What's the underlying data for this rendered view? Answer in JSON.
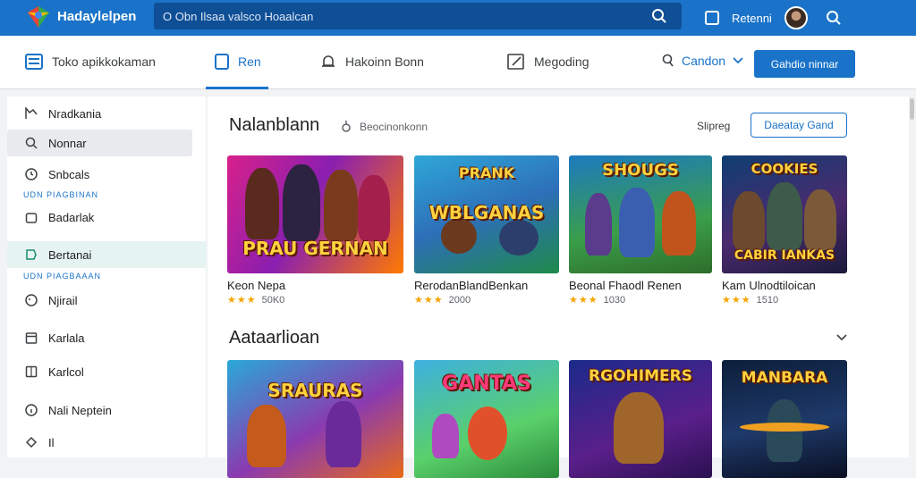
{
  "app": {
    "name": "Hadaylelpen"
  },
  "search": {
    "placeholder": "O Obn Ilsaa valsco Hoaalcan"
  },
  "header": {
    "user_name": "Retenni"
  },
  "nav": {
    "tabs": [
      {
        "label": "Toko apikkokaman"
      },
      {
        "label": "Ren"
      },
      {
        "label": "Hakoinn Bonn"
      },
      {
        "label": "Megoding"
      },
      {
        "label": "Candon"
      }
    ],
    "cta_label": "Gahdio ninnar"
  },
  "sidebar": {
    "items": [
      {
        "label": "Nradkania"
      },
      {
        "label": "Nonnar"
      },
      {
        "label": "Snbcals"
      },
      {
        "label": "Badarlak"
      },
      {
        "label": "Bertanai"
      },
      {
        "label": "Njirail"
      },
      {
        "label": "Karlala"
      },
      {
        "label": "Karlcol"
      },
      {
        "label": "Nali Neptein"
      },
      {
        "label": "Il"
      }
    ],
    "groups": [
      "UDN PIAGBINAN",
      "UDN PIAGBAAAN"
    ]
  },
  "main": {
    "section1": {
      "title": "Nalanblann",
      "sub": "Beocinonkonn",
      "side_label": "Slipreg",
      "button": "Daeatay Gand"
    },
    "section2": {
      "title": "Aataarlioan"
    },
    "cards": [
      {
        "name": "Keon Nepa",
        "rating": "50K0",
        "art": "PRAU GERNAN"
      },
      {
        "name": "RerodanBlandBenkan",
        "rating": "2000",
        "art": "WBLGANAS"
      },
      {
        "name": "Beonal Fhaodl Renen",
        "rating": "1030",
        "art": "SHOUGS"
      },
      {
        "name": "Kam Ulnodtiloican",
        "rating": "1510",
        "art": "CABIR IANKAS"
      }
    ],
    "cards2": [
      {
        "art": "SRAURAS"
      },
      {
        "art": "GANTAS"
      },
      {
        "art": "RGOHIMERS"
      },
      {
        "art": "MANBARA"
      }
    ]
  },
  "colors": {
    "primary": "#1a73c8",
    "star": "#f5a300"
  }
}
